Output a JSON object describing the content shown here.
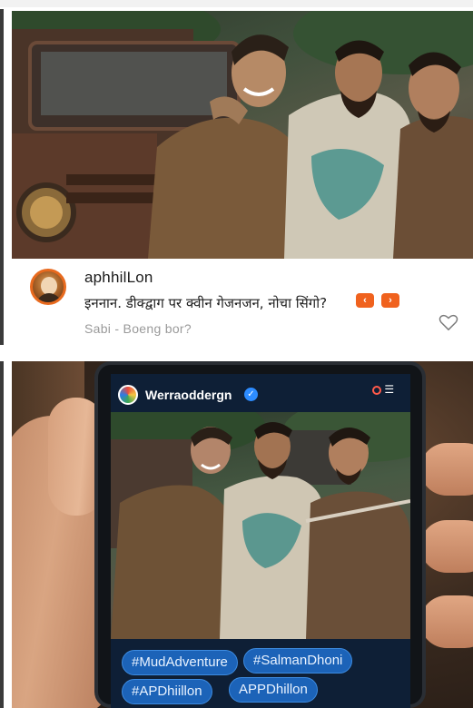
{
  "post": {
    "username": "aphhilLon",
    "caption": "इननान. डीक्द्वाग पर क्वीन गेजनजन, नोचा सिंगो?",
    "subline": "Sabi - Boeng bor?",
    "pill_left": "‹",
    "pill_right": "›",
    "accent_color": "#f0621e"
  },
  "phone": {
    "username": "Werraoddergn",
    "verified_icon": "verified-badge-icon",
    "menu_icon": "menu-icon",
    "hashtags": [
      "#MudAdventure",
      "#SalmanDhoni",
      "#APDhiillon",
      "APPDhillon"
    ],
    "tag_color": "#1c63b8"
  },
  "icons": {
    "heart": "heart-outline-icon"
  }
}
